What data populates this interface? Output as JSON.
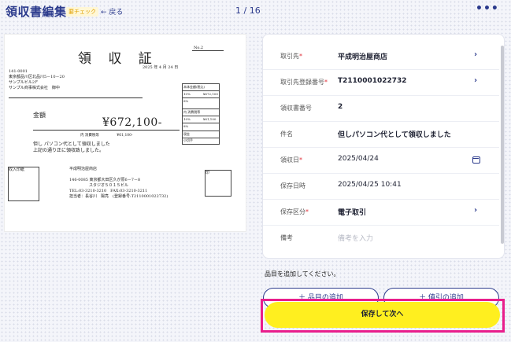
{
  "header": {
    "title": "領収書編集",
    "badge": "要チェック",
    "back_label": "← 戻る",
    "pager": "1 / 16",
    "more_icon": "more-icon"
  },
  "receipt": {
    "title": "領 収 証",
    "no_label": "No.2",
    "date": "2025 年 4 月 24 日",
    "to_lines": [
      "141-0001",
      "東京都品川区北品川5－10－20",
      "サンプルビル2Ｆ",
      "サンプル商事株式会社　御中"
    ],
    "kingaku_label": "金額",
    "amount": "¥672,100-",
    "tax_line": "内 消費税等　　　　　¥61,100-",
    "note_lines": [
      "但し パソコン代として領収しました",
      "上記の通り正に領収致しました。"
    ],
    "tax_box": [
      "本体金額(税込)",
      "10%　　　　¥672,100",
      "8%",
      "内 消費税等",
      "10%　　　　¥61,100",
      "8%",
      "現金",
      "小切手"
    ],
    "stamp_label": "収入印紙",
    "seal_label": "印",
    "issuer_lines": [
      "平成明治屋商店",
      "",
      "146-0085 東京都大田区久が原6－7－8",
      "　　　　　スタジオ５０１５ビル",
      "TEL:03-3210-3210　FAX:03-3210-3211",
      "担当者：長谷川　陽亮　(登録番号:T2110001022732)"
    ]
  },
  "form": {
    "rows": [
      {
        "label": "取引先",
        "required": "*",
        "value": "平成明治屋商店"
      },
      {
        "label": "取引先登録番号",
        "required": "*",
        "value": "T2110001022732"
      },
      {
        "label": "領収書番号",
        "required": "",
        "value": "2"
      },
      {
        "label": "件名",
        "required": "",
        "value": "但しパソコン代として領収しました"
      },
      {
        "label": "領収日",
        "required": "*",
        "value": "2025/04/24"
      },
      {
        "label": "保存日時",
        "required": "",
        "value": "2025/04/25 10:41"
      },
      {
        "label": "保存区分",
        "required": "*",
        "value": "電子取引"
      },
      {
        "label": "備考",
        "required": "",
        "placeholder": "備考を入力"
      }
    ]
  },
  "items_hint": "品目を追加してください。",
  "add_item_label": "＋ 品目の追加",
  "add_discount_label": "＋ 値引の追加",
  "save_next_label": "保存して次へ",
  "colors": {
    "accent": "#2b3a8c",
    "save": "#ffef1f",
    "highlight": "#e91e8c",
    "required": "#e0303a"
  }
}
